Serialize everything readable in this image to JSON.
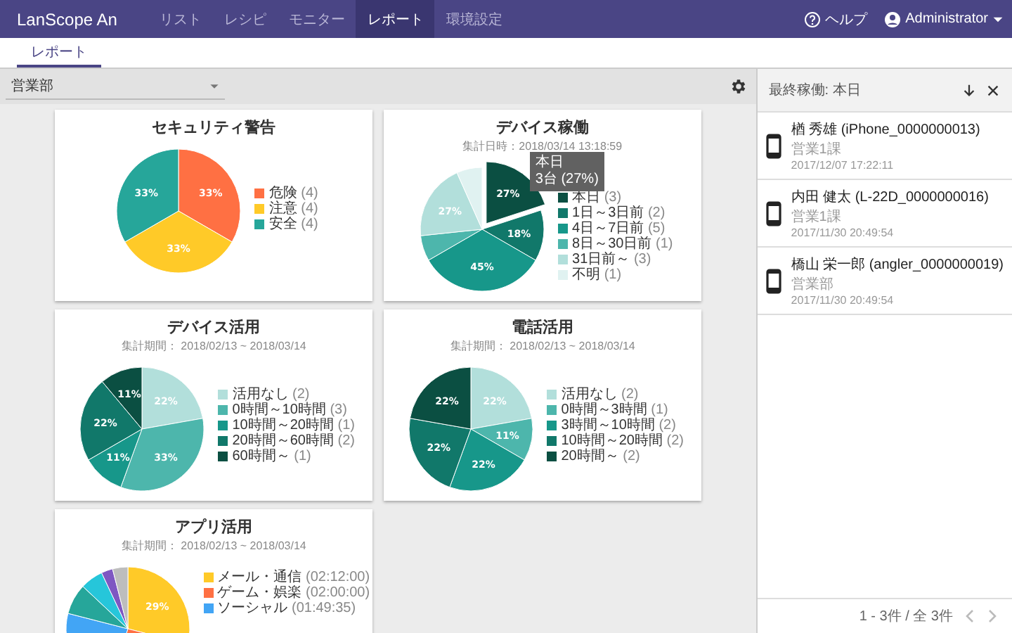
{
  "app_bar": {
    "brand": "LanScope An",
    "nav": [
      {
        "label": "リスト",
        "selected": false
      },
      {
        "label": "レシピ",
        "selected": false
      },
      {
        "label": "モニター",
        "selected": false
      },
      {
        "label": "レポート",
        "selected": true
      },
      {
        "label": "環境設定",
        "selected": false
      }
    ],
    "help": "ヘルプ",
    "user": "Administrator"
  },
  "sub_tabs": [
    {
      "label": "レポート",
      "selected": true
    }
  ],
  "toolbar": {
    "department": "営業部"
  },
  "cards": [
    {
      "title": "セキュリティ警告",
      "chart_data": {
        "type": "pie",
        "legend": "right",
        "categories": [
          "危険",
          "注意",
          "安全"
        ],
        "colors": [
          "#ff7043",
          "#ffca28",
          "#26a69a"
        ],
        "values": [
          33.3,
          33.3,
          33.3
        ],
        "value_labels": [
          "33%",
          "33%",
          "33%"
        ]
      },
      "legend_counts": [
        "(4)",
        "(4)",
        "(4)"
      ]
    },
    {
      "title": "デバイス稼働",
      "subtitle": "集計日時：2018/03/14 13:18:59",
      "chart_data": {
        "type": "pie",
        "legend": "right",
        "categories": [
          "本日",
          "1日～3日前",
          "4日～7日前",
          "8日～30日前",
          "31日前～",
          "不明"
        ],
        "colors": [
          "#0b4f42",
          "#11786a",
          "#17978a",
          "#4db6ac",
          "#b2dfdb",
          "#e0f2f1"
        ],
        "values": [
          27,
          18,
          45,
          9,
          27,
          9
        ],
        "value_labels": [
          "27%",
          "18%",
          "45%",
          null,
          "27%",
          null
        ]
      },
      "tooltip": {
        "title": "本日",
        "text": "3台 (27%)"
      },
      "legend_counts": [
        "(3)",
        "(2)",
        "(5)",
        "(1)",
        "(3)",
        "(1)"
      ]
    },
    {
      "title": "デバイス活用",
      "subtitle": "集計期間： 2018/02/13 ~ 2018/03/14",
      "chart_data": {
        "type": "pie",
        "legend": "right",
        "categories": [
          "活用なし",
          "0時間～10時間",
          "10時間～20時間",
          "20時間～60時間",
          "60時間～"
        ],
        "colors": [
          "#b2dfdb",
          "#4db6ac",
          "#17978a",
          "#11786a",
          "#0b4f42"
        ],
        "values": [
          22,
          33,
          11,
          22,
          11
        ],
        "value_labels": [
          "22%",
          "33%",
          "11%",
          "22%",
          "11%"
        ]
      },
      "legend_counts": [
        "(2)",
        "(3)",
        "(1)",
        "(2)",
        "(1)"
      ]
    },
    {
      "title": "電話活用",
      "subtitle": "集計期間： 2018/02/13 ~ 2018/03/14",
      "chart_data": {
        "type": "pie",
        "legend": "right",
        "categories": [
          "活用なし",
          "0時間～3時間",
          "3時間～10時間",
          "10時間～20時間",
          "20時間～"
        ],
        "colors": [
          "#b2dfdb",
          "#4db6ac",
          "#17978a",
          "#11786a",
          "#0b4f42"
        ],
        "values": [
          22,
          11,
          22,
          22,
          22
        ],
        "value_labels": [
          "22%",
          "11%",
          "22%",
          "22%",
          "22%"
        ]
      },
      "legend_counts": [
        "(2)",
        "(1)",
        "(2)",
        "(2)",
        "(2)"
      ]
    },
    {
      "title": "アプリ活用",
      "subtitle": "集計期間： 2018/02/13 ~ 2018/03/14",
      "chart_data": {
        "type": "pie",
        "legend": "right",
        "categories": [
          "メール・通信",
          "ゲーム・娯楽",
          "ソーシャル",
          null,
          null,
          null,
          null
        ],
        "colors": [
          "#ffca28",
          "#ff7043",
          "#42a5f5",
          "#26a69a",
          "#26c6da",
          "#7e57c2",
          "#bdbdbd"
        ],
        "values": [
          29,
          26,
          24,
          8,
          6,
          3,
          4
        ],
        "value_labels": [
          "29%",
          null,
          null,
          null,
          null,
          null,
          null
        ]
      },
      "legend_counts": [
        "(02:12:00)",
        "(02:00:00)",
        "(01:49:35)"
      ]
    }
  ],
  "side_panel": {
    "title": "最終稼働: 本日",
    "devices": [
      {
        "name": "楢 秀雄 (iPhone_0000000013)",
        "department": "営業1課",
        "time": "2017/12/07 17:22:11"
      },
      {
        "name": "内田 健太 (L-22D_0000000016)",
        "department": "営業1課",
        "time": "2017/11/30 20:49:54"
      },
      {
        "name": "橋山 栄一郎 (angler_0000000019)",
        "department": "営業部",
        "time": "2017/11/30 20:49:54"
      }
    ],
    "pagination": "1 - 3件 / 全 3件"
  }
}
